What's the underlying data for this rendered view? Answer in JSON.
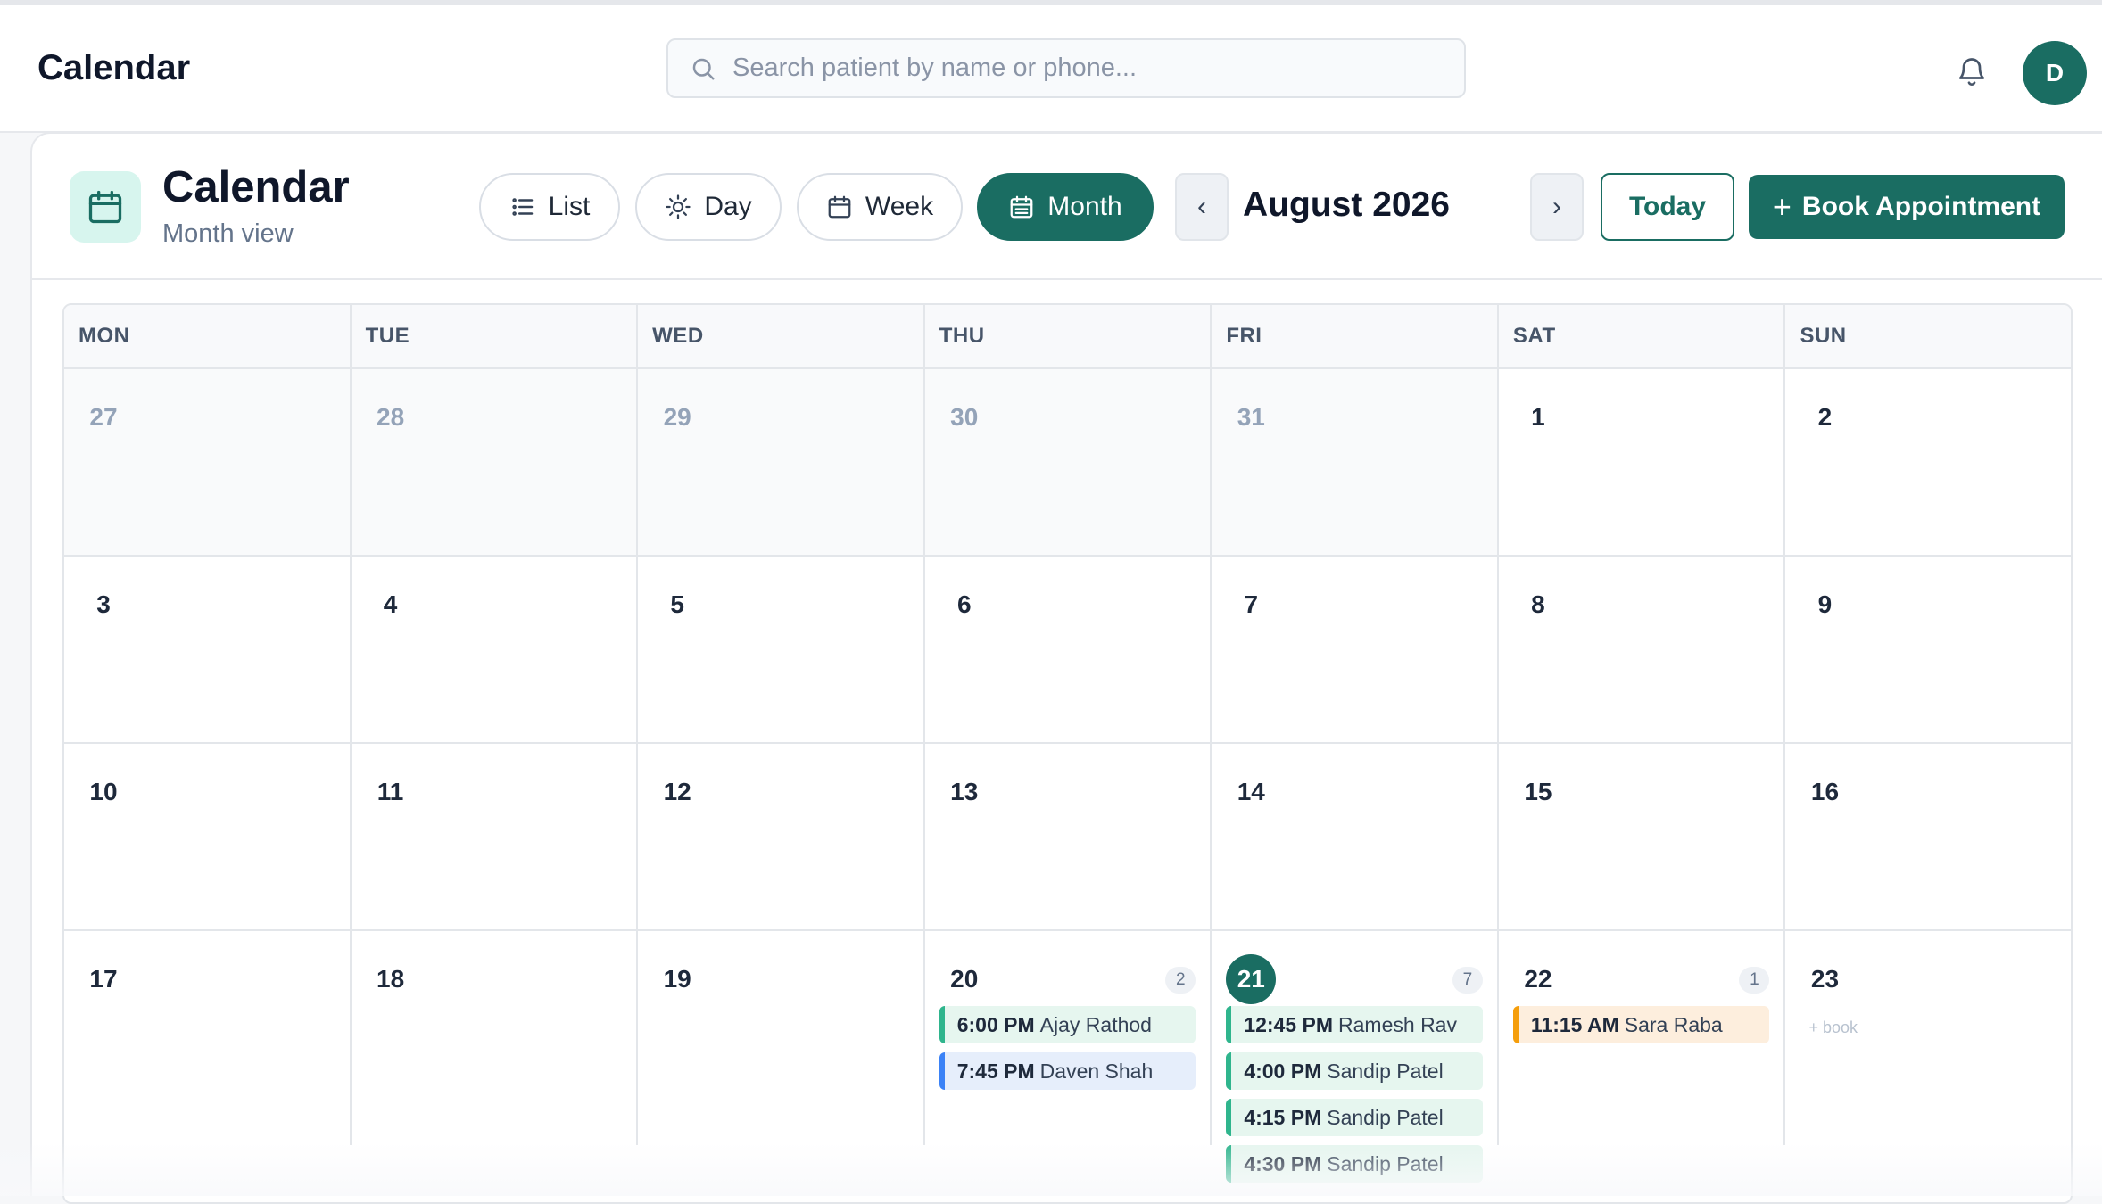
{
  "topbar": {
    "app_title": "Calendar",
    "search_placeholder": "Search patient by name or phone...",
    "avatar_initial": "D"
  },
  "header": {
    "title": "Calendar",
    "subtitle": "Month view",
    "view_buttons": [
      {
        "label": "List",
        "icon": "list-icon",
        "active": false
      },
      {
        "label": "Day",
        "icon": "sun-icon",
        "active": false
      },
      {
        "label": "Week",
        "icon": "calendar-icon",
        "active": false
      },
      {
        "label": "Month",
        "icon": "calendar-grid-icon",
        "active": true
      }
    ],
    "prev_glyph": "‹",
    "next_glyph": "›",
    "month_label": "August 2026",
    "today_label": "Today",
    "book_label": "Book Appointment",
    "book_plus": "+"
  },
  "calendar": {
    "weekdays": [
      "MON",
      "TUE",
      "WED",
      "THU",
      "FRI",
      "SAT",
      "SUN"
    ],
    "weeks": [
      [
        {
          "day": "27",
          "other": true
        },
        {
          "day": "28",
          "other": true
        },
        {
          "day": "29",
          "other": true
        },
        {
          "day": "30",
          "other": true
        },
        {
          "day": "31",
          "other": true
        },
        {
          "day": "1"
        },
        {
          "day": "2"
        }
      ],
      [
        {
          "day": "3"
        },
        {
          "day": "4"
        },
        {
          "day": "5"
        },
        {
          "day": "6"
        },
        {
          "day": "7"
        },
        {
          "day": "8"
        },
        {
          "day": "9"
        }
      ],
      [
        {
          "day": "10"
        },
        {
          "day": "11"
        },
        {
          "day": "12"
        },
        {
          "day": "13"
        },
        {
          "day": "14"
        },
        {
          "day": "15"
        },
        {
          "day": "16"
        }
      ],
      [
        {
          "day": "17"
        },
        {
          "day": "18"
        },
        {
          "day": "19"
        },
        {
          "day": "20",
          "count": "2",
          "appointments": [
            {
              "time": "6:00 PM",
              "name": "Ajay Rathod",
              "color": "green"
            },
            {
              "time": "7:45 PM",
              "name": "Daven Shah",
              "color": "blue"
            }
          ]
        },
        {
          "day": "21",
          "today": true,
          "count": "7",
          "appointments": [
            {
              "time": "12:45 PM",
              "name": "Ramesh Rav",
              "color": "green"
            },
            {
              "time": "4:00 PM",
              "name": "Sandip Patel",
              "color": "green"
            },
            {
              "time": "4:15 PM",
              "name": "Sandip Patel",
              "color": "green"
            },
            {
              "time": "4:30 PM",
              "name": "Sandip Patel",
              "color": "green"
            }
          ]
        },
        {
          "day": "22",
          "count": "1",
          "appointments": [
            {
              "time": "11:15 AM",
              "name": "Sara Raba",
              "color": "orange"
            }
          ]
        },
        {
          "day": "23",
          "quick_book": "+ book"
        }
      ]
    ]
  },
  "colors": {
    "accent": "#1a6d62",
    "appt_green": "#2fb58d",
    "appt_blue": "#3b82f6",
    "appt_orange": "#f59e0b"
  }
}
